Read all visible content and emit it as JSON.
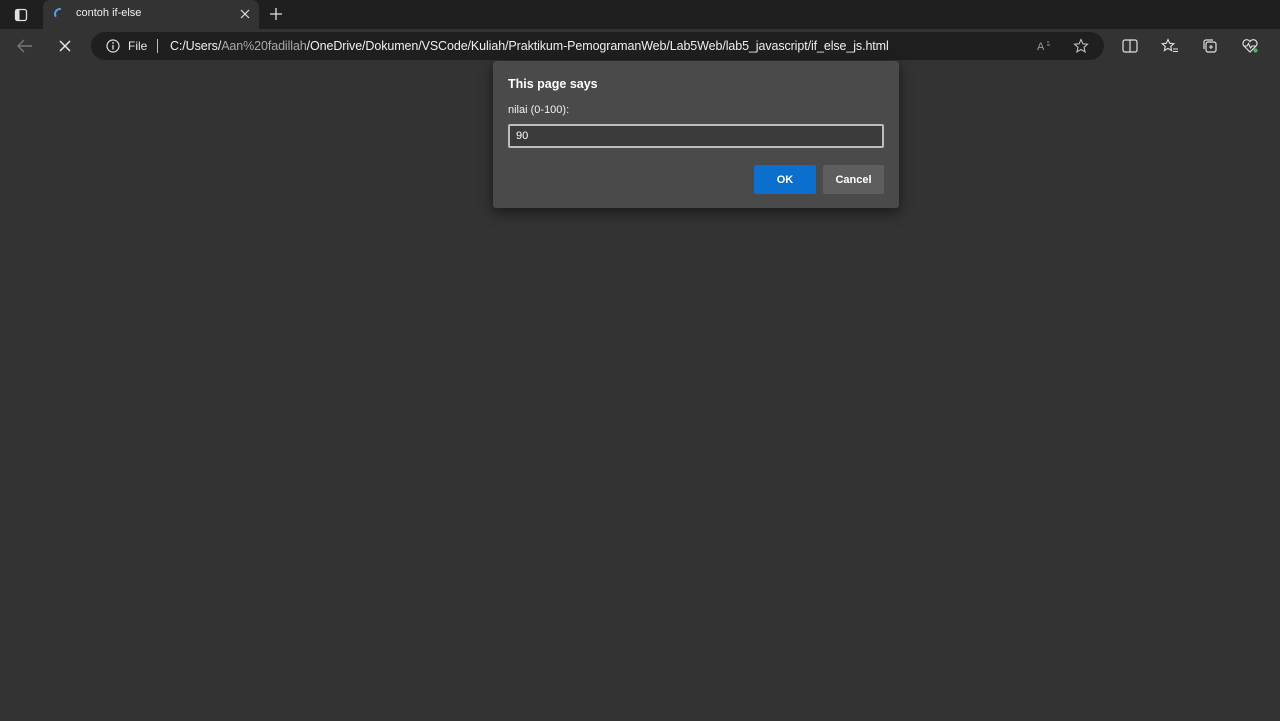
{
  "browser": {
    "tab": {
      "title": "contoh if-else"
    },
    "address": {
      "scheme_label": "File",
      "url_prefix": "C:/Users/",
      "url_dim": "Aan%20fadillah",
      "url_suffix": "/OneDrive/Dokumen/VSCode/Kuliah/Praktikum-PemogramanWeb/Lab5Web/lab5_javascript/if_else_js.html"
    },
    "icons": {
      "tab_actions": "tab-actions-icon",
      "loading": "loading-spinner-icon",
      "close_tab": "close-icon",
      "new_tab": "plus-icon",
      "back": "arrow-left-icon",
      "stop": "stop-x-icon",
      "info": "info-icon",
      "read_aloud": "read-aloud-icon",
      "favorite": "star-icon",
      "split_screen": "split-screen-icon",
      "favorites": "favorites-icon",
      "collections": "collections-icon",
      "performance": "heart-pulse-icon"
    },
    "colors": {
      "accent": "#0b6fce",
      "chrome": "#1f1f1f",
      "page": "#333333",
      "dialog": "#4a4a4a"
    }
  },
  "dialog": {
    "title": "This page says",
    "message": "nilai (0-100):",
    "input_value": "90",
    "ok_label": "OK",
    "cancel_label": "Cancel"
  }
}
